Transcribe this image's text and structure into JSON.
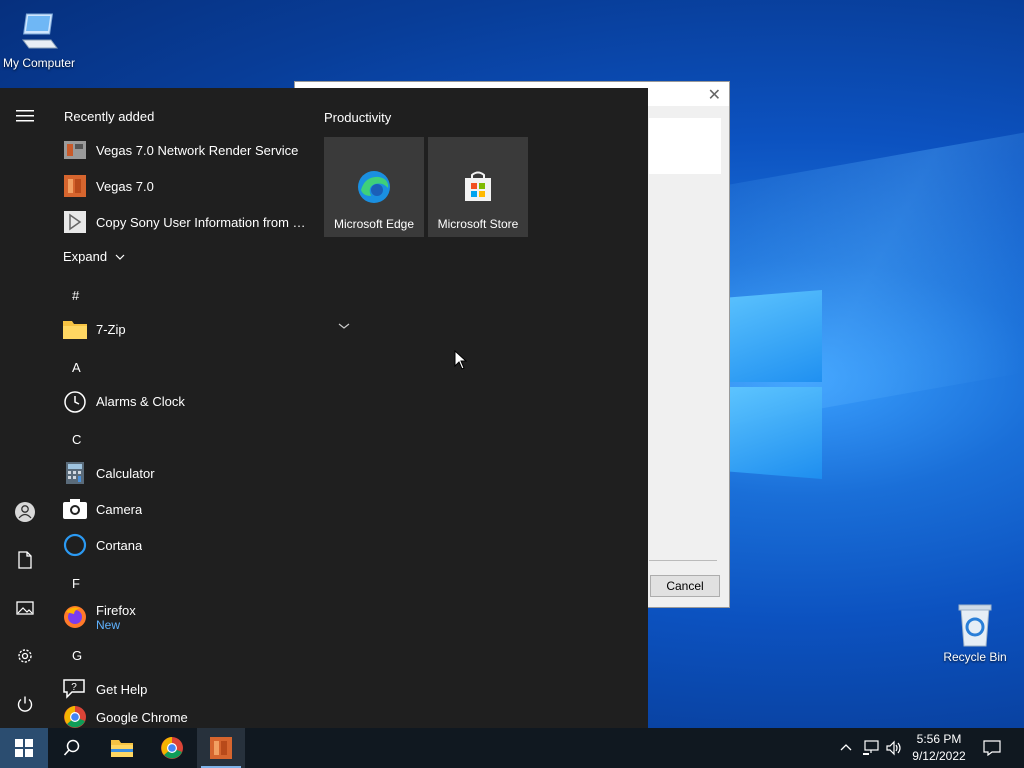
{
  "desktop": {
    "icons": [
      {
        "label": "My Computer"
      },
      {
        "label": "Recycle Bin"
      }
    ]
  },
  "dialog": {
    "close_glyph": "✕",
    "cancel_label": "Cancel"
  },
  "start_menu": {
    "recently_added_label": "Recently added",
    "recent": [
      {
        "label": "Vegas 7.0 Network Render Service",
        "icon": "render-service-icon"
      },
      {
        "label": "Vegas 7.0",
        "icon": "vegas-icon"
      },
      {
        "label": "Copy Sony User Information from So...",
        "icon": "shortcut-icon"
      }
    ],
    "expand_label": "Expand",
    "letters": [
      "#",
      "A",
      "C",
      "F",
      "G"
    ],
    "apps": [
      {
        "label": "7-Zip",
        "icon": "folder-icon"
      },
      {
        "label": "Alarms & Clock",
        "icon": "clock-icon"
      },
      {
        "label": "Calculator",
        "icon": "calculator-icon"
      },
      {
        "label": "Camera",
        "icon": "camera-icon"
      },
      {
        "label": "Cortana",
        "icon": "cortana-icon"
      },
      {
        "label": "Firefox",
        "sub": "New",
        "icon": "firefox-icon"
      },
      {
        "label": "Get Help",
        "icon": "help-icon"
      },
      {
        "label": "Google Chrome",
        "icon": "chrome-icon"
      }
    ],
    "group_title": "Productivity",
    "tiles": [
      {
        "label": "Microsoft Edge",
        "icon": "edge-icon"
      },
      {
        "label": "Microsoft Store",
        "icon": "store-icon"
      }
    ]
  },
  "taskbar": {
    "time": "5:56 PM",
    "date": "9/12/2022"
  },
  "colors": {
    "start_bg": "#1f1f1f",
    "tile_bg": "#3a3a3a",
    "accent_new": "#5fb2ff",
    "taskbar_bg": "#101820"
  }
}
